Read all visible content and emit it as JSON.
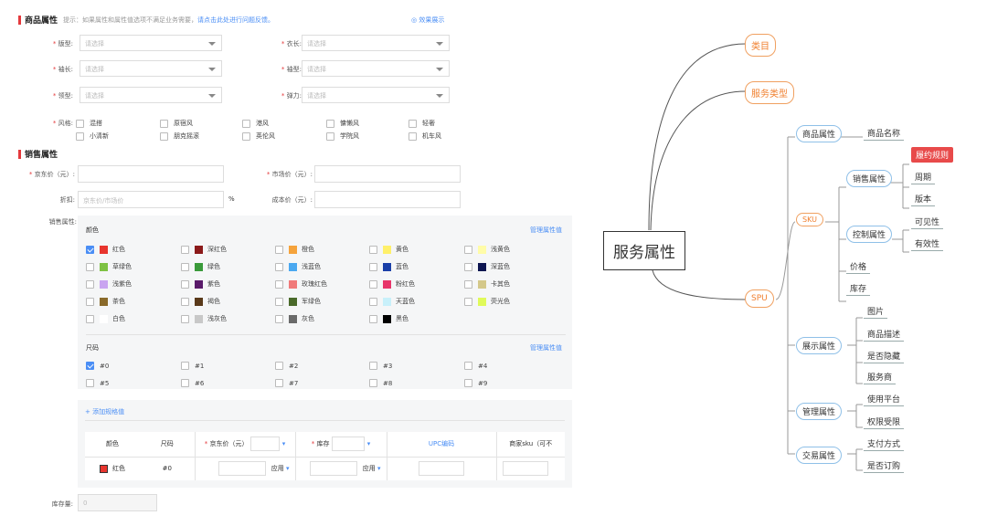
{
  "product_attrs": {
    "title": "商品属性",
    "tip_prefix": "提示：如果属性和属性值选项不满足业务需要，",
    "tip_link": "请点击此处进行问题反馈。",
    "effect_link": "效果展示",
    "fields": [
      {
        "label": "版型:",
        "placeholder": "请选择"
      },
      {
        "label": "衣长:",
        "placeholder": "请选择"
      },
      {
        "label": "袖长:",
        "placeholder": "请选择"
      },
      {
        "label": "袖型:",
        "placeholder": "请选择"
      },
      {
        "label": "领型:",
        "placeholder": "请选择"
      },
      {
        "label": "弹力:",
        "placeholder": "请选择"
      }
    ],
    "style_label": "风格:",
    "styles": [
      "混搭",
      "原宿风",
      "港风",
      "慵懒风",
      "轻奢",
      "小清新",
      "朋克摇滚",
      "英伦风",
      "学院风",
      "机车风"
    ]
  },
  "sales_attrs": {
    "title": "销售属性",
    "jd_price_label": "京东价（元）:",
    "market_price_label": "市场价（元）:",
    "discount_label": "折扣:",
    "discount_placeholder": "京东价/市场价",
    "percent": "%",
    "cost_label": "成本价（元）:",
    "sales_attr_label": "销售属性:",
    "color_title": "颜色",
    "manage_link": "管理属性值",
    "colors": [
      {
        "name": "红色",
        "hex": "#e8352e",
        "checked": true
      },
      {
        "name": "深红色",
        "hex": "#8b1a1a"
      },
      {
        "name": "橙色",
        "hex": "#f5a33c"
      },
      {
        "name": "黄色",
        "hex": "#fff06a"
      },
      {
        "name": "浅黄色",
        "hex": "#fffca8"
      },
      {
        "name": "草绿色",
        "hex": "#7ec243"
      },
      {
        "name": "绿色",
        "hex": "#3a9a3a"
      },
      {
        "name": "浅蓝色",
        "hex": "#4aa8f0"
      },
      {
        "name": "蓝色",
        "hex": "#1a3fa8"
      },
      {
        "name": "深蓝色",
        "hex": "#0d1550"
      },
      {
        "name": "浅紫色",
        "hex": "#c9a4f0"
      },
      {
        "name": "紫色",
        "hex": "#5a1a6a"
      },
      {
        "name": "玫瑰红色",
        "hex": "#f07a7a"
      },
      {
        "name": "粉红色",
        "hex": "#e8356a"
      },
      {
        "name": "卡其色",
        "hex": "#d4c88a"
      },
      {
        "name": "茶色",
        "hex": "#8a6a2a"
      },
      {
        "name": "褐色",
        "hex": "#5a3a1a"
      },
      {
        "name": "军绿色",
        "hex": "#4a6a2a"
      },
      {
        "name": "天蓝色",
        "hex": "#c8f0fa"
      },
      {
        "name": "荧光色",
        "hex": "#e0fa5a"
      },
      {
        "name": "白色",
        "hex": "#ffffff"
      },
      {
        "name": "浅灰色",
        "hex": "#c8c8c8"
      },
      {
        "name": "灰色",
        "hex": "#6a6a6a"
      },
      {
        "name": "黑色",
        "hex": "#000000"
      }
    ],
    "size_title": "尺码",
    "sizes": [
      {
        "name": "#0",
        "checked": true
      },
      {
        "name": "#1"
      },
      {
        "name": "#2"
      },
      {
        "name": "#3"
      },
      {
        "name": "#4"
      },
      {
        "name": "#5"
      },
      {
        "name": "#6"
      },
      {
        "name": "#7"
      },
      {
        "name": "#8"
      },
      {
        "name": "#9"
      }
    ],
    "add_spec": "+ 添加规格值",
    "table": {
      "headers": [
        "颜色",
        "尺码",
        "京东价（元）",
        "库存",
        "UPC编码",
        "商家sku（可不"
      ],
      "row": {
        "color": "红色",
        "size": "#0",
        "apply": "应用"
      }
    },
    "stock_label": "库存量:",
    "stock_value": "0"
  },
  "mindmap": {
    "root": "服务属性",
    "branch1": "类目",
    "branch2": "服务类型",
    "spu": "SPU",
    "sku": "SKU",
    "product_attr": "商品属性",
    "product_name": "商品名称",
    "sales_attr": "销售属性",
    "fulfil_rule": "履约规则",
    "period": "周期",
    "version": "版本",
    "control_attr": "控制属性",
    "visible": "可见性",
    "validity": "有效性",
    "price": "价格",
    "stock": "库存",
    "display_attr": "展示属性",
    "image": "图片",
    "desc": "商品描述",
    "hidden": "是否隐藏",
    "provider": "服务商",
    "manage_attr": "管理属性",
    "platform": "使用平台",
    "perm": "权限受限",
    "trade_attr": "交易属性",
    "pay": "支付方式",
    "subscribe": "是否订购"
  },
  "colors": {
    "accent": "#e4393c",
    "link": "#4a8ef5",
    "mind_orange": "#f08030",
    "mind_red": "#e84a4a"
  }
}
